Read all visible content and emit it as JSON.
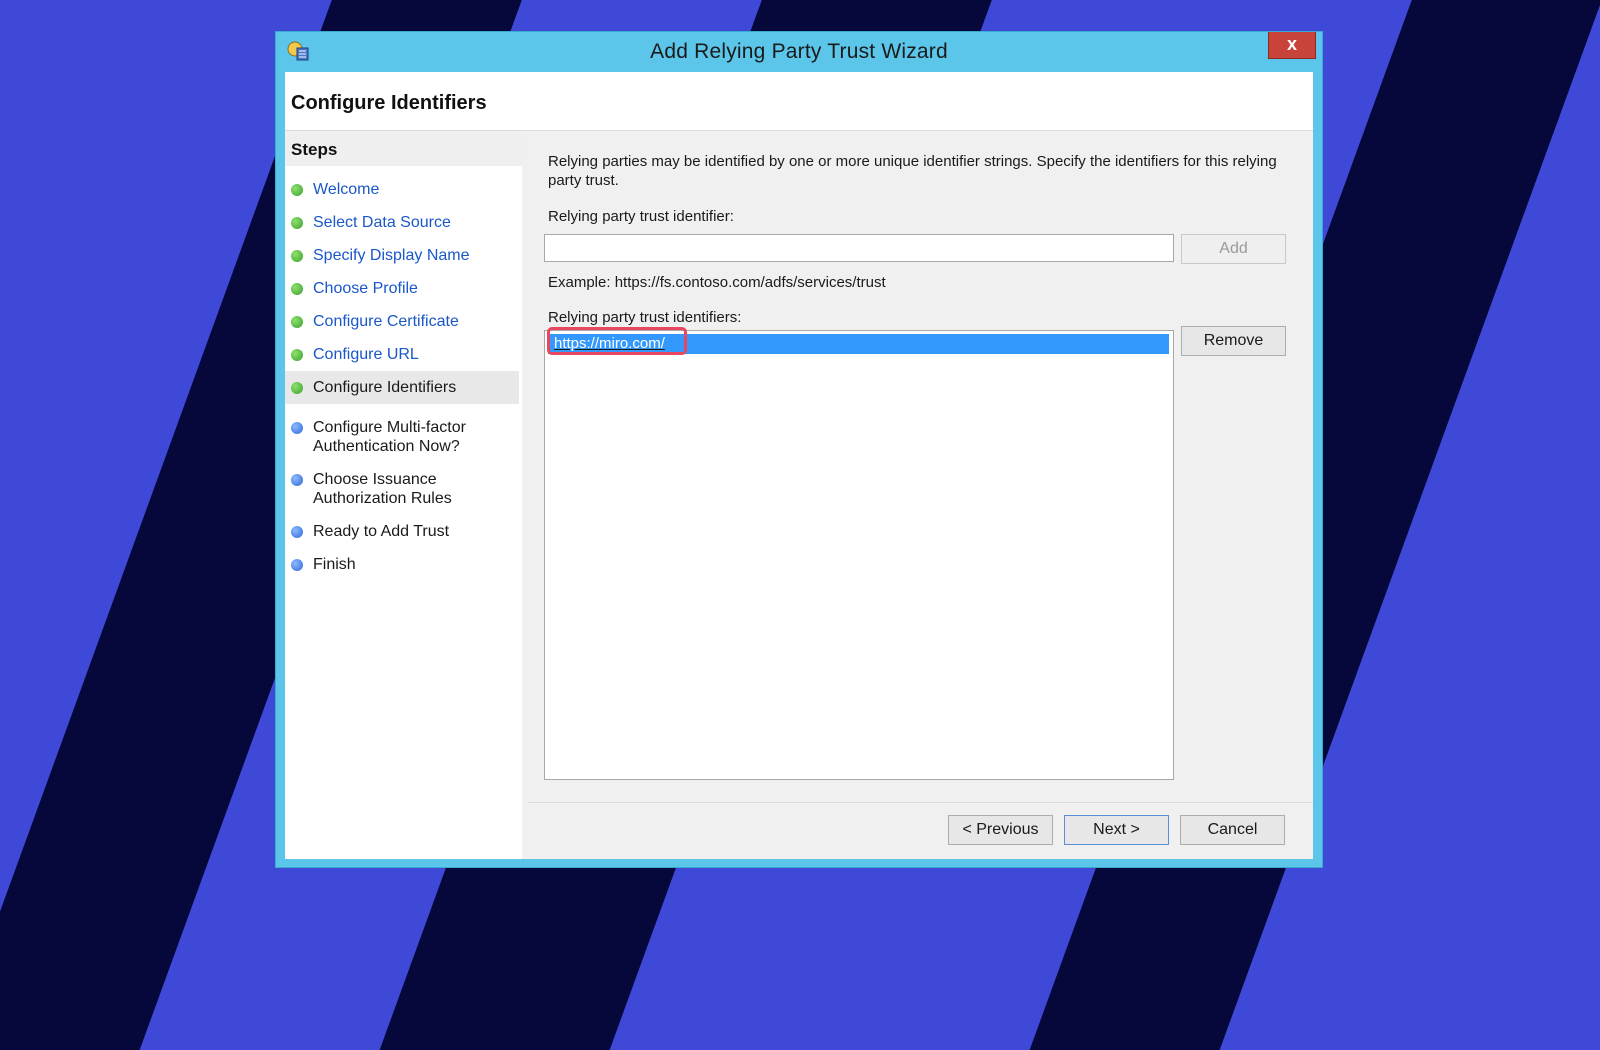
{
  "window": {
    "title": "Add Relying Party Trust Wizard",
    "close_label": "x"
  },
  "page_title": "Configure Identifiers",
  "steps": {
    "header": "Steps",
    "items": [
      {
        "label": "Welcome",
        "state": "done"
      },
      {
        "label": "Select Data Source",
        "state": "done"
      },
      {
        "label": "Specify Display Name",
        "state": "done"
      },
      {
        "label": "Choose Profile",
        "state": "done"
      },
      {
        "label": "Configure Certificate",
        "state": "done"
      },
      {
        "label": "Configure URL",
        "state": "done"
      },
      {
        "label": "Configure Identifiers",
        "state": "current"
      },
      {
        "label": "Configure Multi-factor Authentication Now?",
        "state": "pending"
      },
      {
        "label": "Choose Issuance Authorization Rules",
        "state": "pending"
      },
      {
        "label": "Ready to Add Trust",
        "state": "pending"
      },
      {
        "label": "Finish",
        "state": "pending"
      }
    ]
  },
  "content": {
    "description": "Relying parties may be identified by one or more unique identifier strings. Specify the identifiers for this relying party trust.",
    "identifier_label": "Relying party trust identifier:",
    "identifier_value": "",
    "add_button": "Add",
    "example_text": "Example: https://fs.contoso.com/adfs/services/trust",
    "identifiers_label": "Relying party trust identifiers:",
    "identifiers": [
      "https://miro.com/"
    ],
    "remove_button": "Remove"
  },
  "footer": {
    "previous_button": "< Previous",
    "next_button": "Next >",
    "cancel_button": "Cancel"
  },
  "colors": {
    "background": "#3f49d8",
    "stripes": "#06073a",
    "window_frame": "#5bc6ea",
    "selection": "#3399ff",
    "highlight": "#e8475f",
    "link": "#1a57c8"
  }
}
